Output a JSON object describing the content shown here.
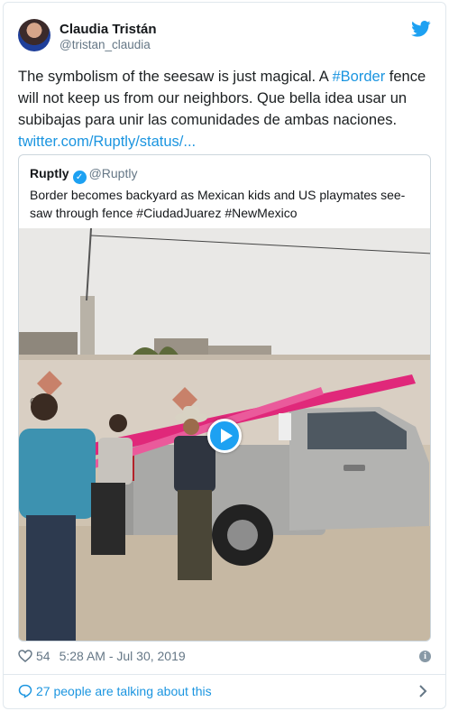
{
  "author": {
    "name": "Claudia Tristán",
    "handle": "@tristan_claudia"
  },
  "tweet": {
    "text_1": "The symbolism of the seesaw is just magical. A ",
    "hashtag": "#Border",
    "text_2": " fence will not keep us from our neighbors. Que bella idea usar un subibajas para unir las comunidades de ambas naciones. ",
    "link": "twitter.com/Ruptly/status/..."
  },
  "quoted": {
    "name": "Ruptly",
    "handle": "@Ruptly",
    "text": "Border becomes backyard as Mexican kids and US playmates see-saw through fence #CiudadJuarez #NewMexico"
  },
  "meta": {
    "likes": "54",
    "timestamp": "5:28 AM - Jul 30, 2019"
  },
  "conversation": {
    "label": "27 people are talking about this"
  },
  "icons": {
    "bird": "twitter-bird-icon",
    "verified": "verified-badge-icon",
    "play": "play-icon",
    "heart": "heart-icon",
    "info": "info-icon",
    "bubble": "speech-bubble-icon",
    "chevron": "chevron-right-icon"
  },
  "colors": {
    "accent": "#1da1f2",
    "link": "#1b95e0",
    "muted": "#657786",
    "seesaw": "#e0287a"
  }
}
